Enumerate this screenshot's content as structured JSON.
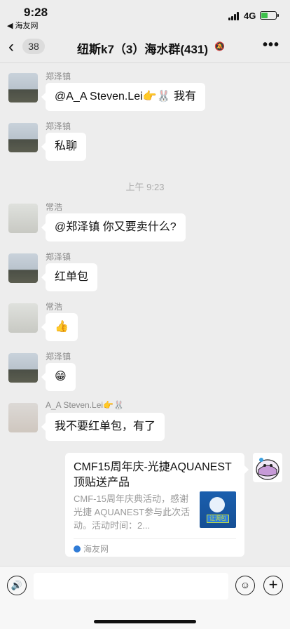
{
  "status_bar": {
    "time": "9:28",
    "back_app": "◀ 海友网",
    "network": "4G",
    "battery_level": 0.45
  },
  "nav": {
    "back_glyph": "‹",
    "unread_count": "38",
    "title": "纽斯k7（3）海水群(431)",
    "mute_glyph": "🔕",
    "more_glyph": "•••"
  },
  "messages": [
    {
      "sender": "郑泽镇",
      "text": "@A_A Steven.Lei👉🐰 我有",
      "avatar": "soldier-avatar"
    },
    {
      "sender": "郑泽镇",
      "text": "私聊",
      "avatar": "soldier-avatar"
    },
    {
      "sender": "常浩",
      "text": "@郑泽镇 你又要卖什么?",
      "avatar": "cat-avatar"
    },
    {
      "sender": "郑泽镇",
      "text": "红单包",
      "avatar": "soldier-avatar"
    },
    {
      "sender": "常浩",
      "text": "👍",
      "avatar": "cat-avatar"
    },
    {
      "sender": "郑泽镇",
      "text": "😁",
      "avatar": "soldier-avatar"
    },
    {
      "sender": "A_A Steven.Lei👉🐰",
      "text": "我不要红单包，有了",
      "avatar": "person-avatar"
    }
  ],
  "timestamp": "上午 9:23",
  "link_card": {
    "title": "CMF15周年庆-光捷AQUANEST顶贴送产品",
    "description": "CMF-15周年庆典活动，感谢光捷 AQUANEST参与此次活动。活动时间：2...",
    "source": "海友网",
    "thumb_tag": "让调包"
  },
  "input_bar": {
    "voice_glyph": "🔊",
    "emoji_glyph": "☺",
    "plus_glyph": "+"
  }
}
